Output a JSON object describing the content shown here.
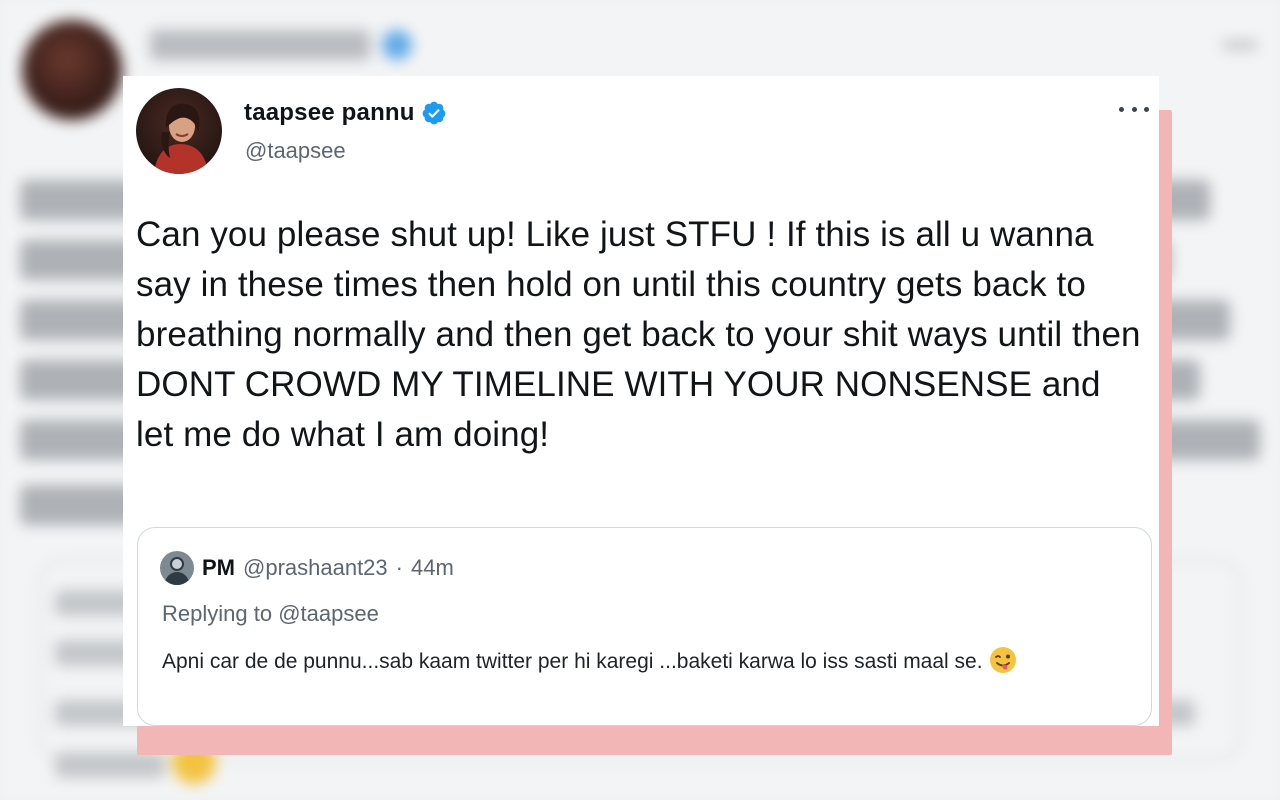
{
  "tweet": {
    "author": {
      "name": "taapsee pannu",
      "handle": "@taapsee",
      "verified": true
    },
    "text": "Can you please shut up! Like just STFU ! If this is all u wanna say in these times then hold on until this country gets back to breathing normally and then get back to your shit ways until then DONT CROWD MY TIMELINE WITH YOUR NONSENSE and let me do what I am doing!",
    "more_icon": "more-horizontal-icon",
    "quoted": {
      "name": "PM",
      "handle": "@prashaant23",
      "separator": "·",
      "time": "44m",
      "replying_prefix": "Replying to",
      "replying_handle": "@taapsee",
      "text": "Apni car de de punnu...sab kaam twitter per hi karegi ...baketi karwa lo iss sasti maal se.",
      "emoji": "winking-face-with-tongue-icon"
    }
  },
  "colors": {
    "verified_blue": "#1d9bf0",
    "highlight_pink": "#f3b6b6",
    "secondary_text": "#5b6670",
    "border": "#cfd9de"
  }
}
